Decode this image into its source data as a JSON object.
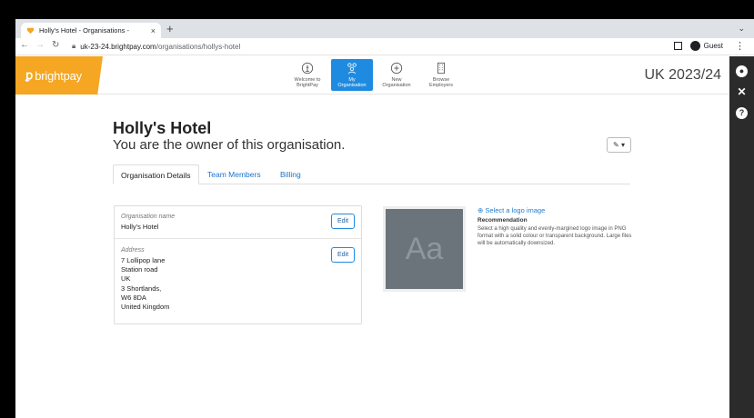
{
  "browser": {
    "tab_title": "Holly's Hotel - Organisations - ×",
    "tab_title_text": "Holly's Hotel - Organisations -",
    "new_tab": "+",
    "url_host": "uk-23-24.brightpay.com",
    "url_path": "/organisations/hollys-hotel",
    "profile": "Guest"
  },
  "app": {
    "logo_text": "brightpay",
    "year": "UK 2023/24",
    "nav": [
      {
        "label1": "Welcome to",
        "label2": "BrightPay"
      },
      {
        "label1": "My",
        "label2": "Organisation"
      },
      {
        "label1": "New",
        "label2": "Organisation"
      },
      {
        "label1": "Browse",
        "label2": "Employers"
      }
    ]
  },
  "page": {
    "org_name": "Holly's Hotel",
    "owner_text": "You are the owner of this organisation.",
    "wrench_label": "✎ ▾",
    "tabs": [
      "Organisation Details",
      "Team Members",
      "Billing"
    ],
    "fields": {
      "org_name_label": "Organisation name",
      "org_name_value": "Holly's Hotel",
      "address_label": "Address",
      "address_lines": [
        "7 Lollipop lane",
        "Station road",
        "UK",
        "3 Shortlands,",
        "W6 8DA",
        "United Kingdom"
      ]
    },
    "edit_label": "Edit",
    "logo_placeholder": "Aa",
    "select_logo": "Select a logo image",
    "recommendation_title": "Recommendation",
    "recommendation_text": "Select a high quality and evenly-margined logo image in PNG format with a solid colour or transparent background. Large files will be automatically downsized."
  }
}
